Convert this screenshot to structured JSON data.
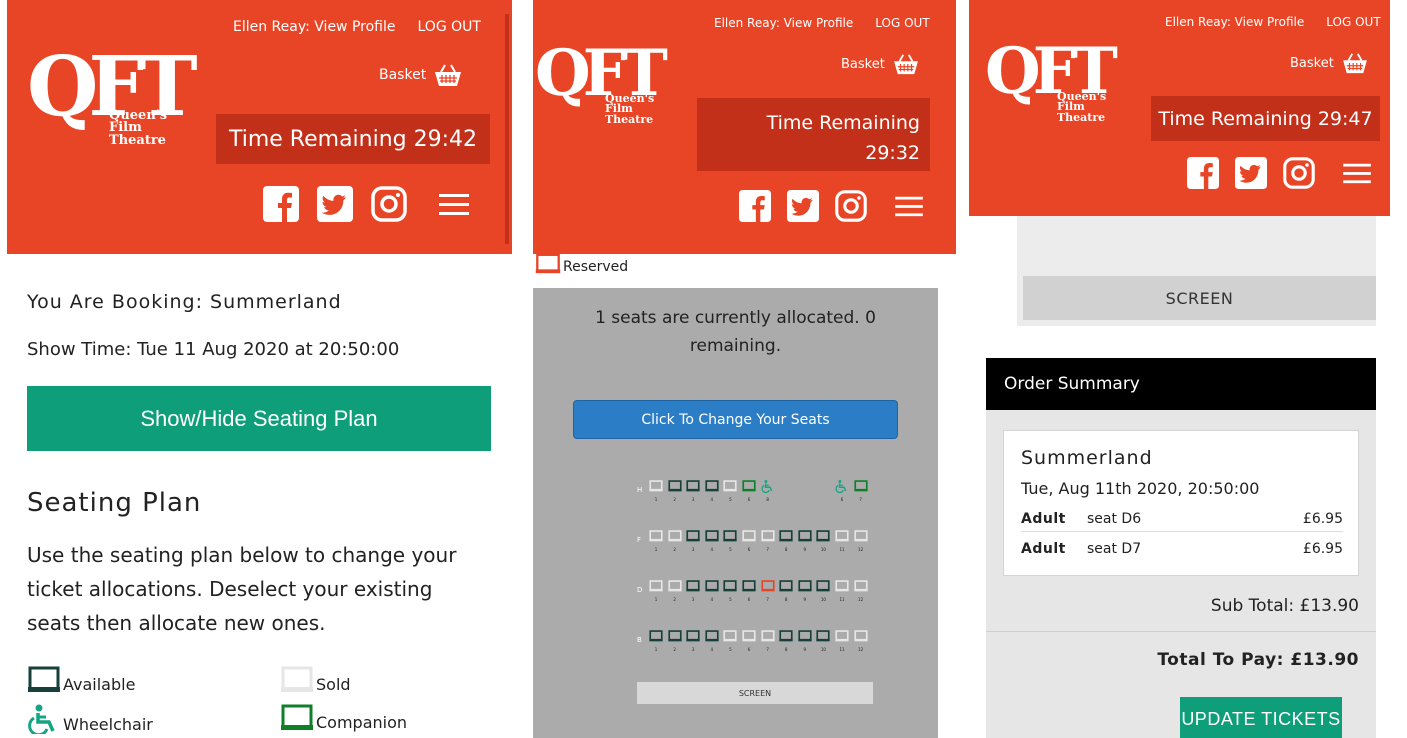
{
  "colors": {
    "brand": "#e84527",
    "timer": "#c3301a",
    "green": "#0e9e7a",
    "blue": "#2b7ec5",
    "dark_seat": "#17403a",
    "sold_seat": "#e6e6e6",
    "companion": "#0f7f2a",
    "wheelchair": "#15a583",
    "reserved": "#e84527"
  },
  "header": {
    "user_link": "Ellen Reay: View Profile",
    "logout": "LOG OUT",
    "logo_text": "Queen's Film Theatre",
    "basket": "Basket",
    "icons": [
      "facebook-icon",
      "twitter-icon",
      "instagram-icon",
      "menu-icon"
    ]
  },
  "panel1": {
    "timer": "Time Remaining 29:42",
    "booking_title": "You Are Booking: Summerland",
    "show_time": "Show Time: Tue 11 Aug 2020 at 20:50:00",
    "toggle_button": "Show/Hide Seating Plan",
    "plan_heading": "Seating Plan",
    "plan_desc": "Use the seating plan below to change your ticket allocations. Deselect your existing seats then allocate new ones.",
    "legend": {
      "available": "Available",
      "sold": "Sold",
      "wheelchair": "Wheelchair",
      "companion": "Companion"
    }
  },
  "panel2": {
    "timer_line1": "Time Remaining",
    "timer_line2": "29:32",
    "reserved_label": "Reserved",
    "alloc_text": "1 seats are currently allocated. 0 remaining.",
    "change_button": "Click To Change Your Seats",
    "screen": "SCREEN",
    "rows": [
      {
        "label": "H",
        "seats": [
          {
            "t": "sold",
            "n": "1"
          },
          {
            "t": "available",
            "n": "2"
          },
          {
            "t": "available",
            "n": "3"
          },
          {
            "t": "available",
            "n": "4"
          },
          {
            "t": "sold",
            "n": "5"
          },
          {
            "t": "companion",
            "n": "6"
          },
          {
            "t": "wheelchair",
            "n": "8"
          },
          {
            "t": "gap",
            "n": ""
          },
          {
            "t": "gap",
            "n": ""
          },
          {
            "t": "gap",
            "n": ""
          },
          {
            "t": "wheelchair",
            "n": "6"
          },
          {
            "t": "companion",
            "n": "7"
          }
        ]
      },
      {
        "label": "F",
        "seats": [
          {
            "t": "sold",
            "n": "1"
          },
          {
            "t": "sold",
            "n": "2"
          },
          {
            "t": "available",
            "n": "3"
          },
          {
            "t": "available",
            "n": "4"
          },
          {
            "t": "available",
            "n": "5"
          },
          {
            "t": "sold",
            "n": "6"
          },
          {
            "t": "sold",
            "n": "7"
          },
          {
            "t": "available",
            "n": "8"
          },
          {
            "t": "available",
            "n": "9"
          },
          {
            "t": "available",
            "n": "10"
          },
          {
            "t": "sold",
            "n": "11"
          },
          {
            "t": "sold",
            "n": "12"
          }
        ]
      },
      {
        "label": "D",
        "seats": [
          {
            "t": "sold",
            "n": "1"
          },
          {
            "t": "sold",
            "n": "2"
          },
          {
            "t": "available",
            "n": "3"
          },
          {
            "t": "available",
            "n": "4"
          },
          {
            "t": "available",
            "n": "5"
          },
          {
            "t": "available",
            "n": "6"
          },
          {
            "t": "reserved",
            "n": "7"
          },
          {
            "t": "available",
            "n": "8"
          },
          {
            "t": "available",
            "n": "9"
          },
          {
            "t": "available",
            "n": "10"
          },
          {
            "t": "sold",
            "n": "11"
          },
          {
            "t": "sold",
            "n": "12"
          }
        ]
      },
      {
        "label": "B",
        "seats": [
          {
            "t": "available",
            "n": "1"
          },
          {
            "t": "available",
            "n": "2"
          },
          {
            "t": "available",
            "n": "3"
          },
          {
            "t": "available",
            "n": "4"
          },
          {
            "t": "sold",
            "n": "5"
          },
          {
            "t": "sold",
            "n": "6"
          },
          {
            "t": "sold",
            "n": "7"
          },
          {
            "t": "available",
            "n": "8"
          },
          {
            "t": "available",
            "n": "9"
          },
          {
            "t": "available",
            "n": "10"
          },
          {
            "t": "sold",
            "n": "11"
          },
          {
            "t": "sold",
            "n": "12"
          }
        ]
      }
    ]
  },
  "panel3": {
    "timer": "Time Remaining 29:47",
    "screen": "SCREEN",
    "order_summary": "Order Summary",
    "film": "Summerland",
    "date": "Tue, Aug 11th 2020, 20:50:00",
    "tickets": [
      {
        "type": "Adult",
        "seat": "seat D6",
        "price": "£6.95"
      },
      {
        "type": "Adult",
        "seat": "seat D7",
        "price": "£6.95"
      }
    ],
    "sub_total": "Sub Total: £13.90",
    "total": "Total To Pay: £13.90",
    "update_button": "UPDATE TICKETS"
  }
}
